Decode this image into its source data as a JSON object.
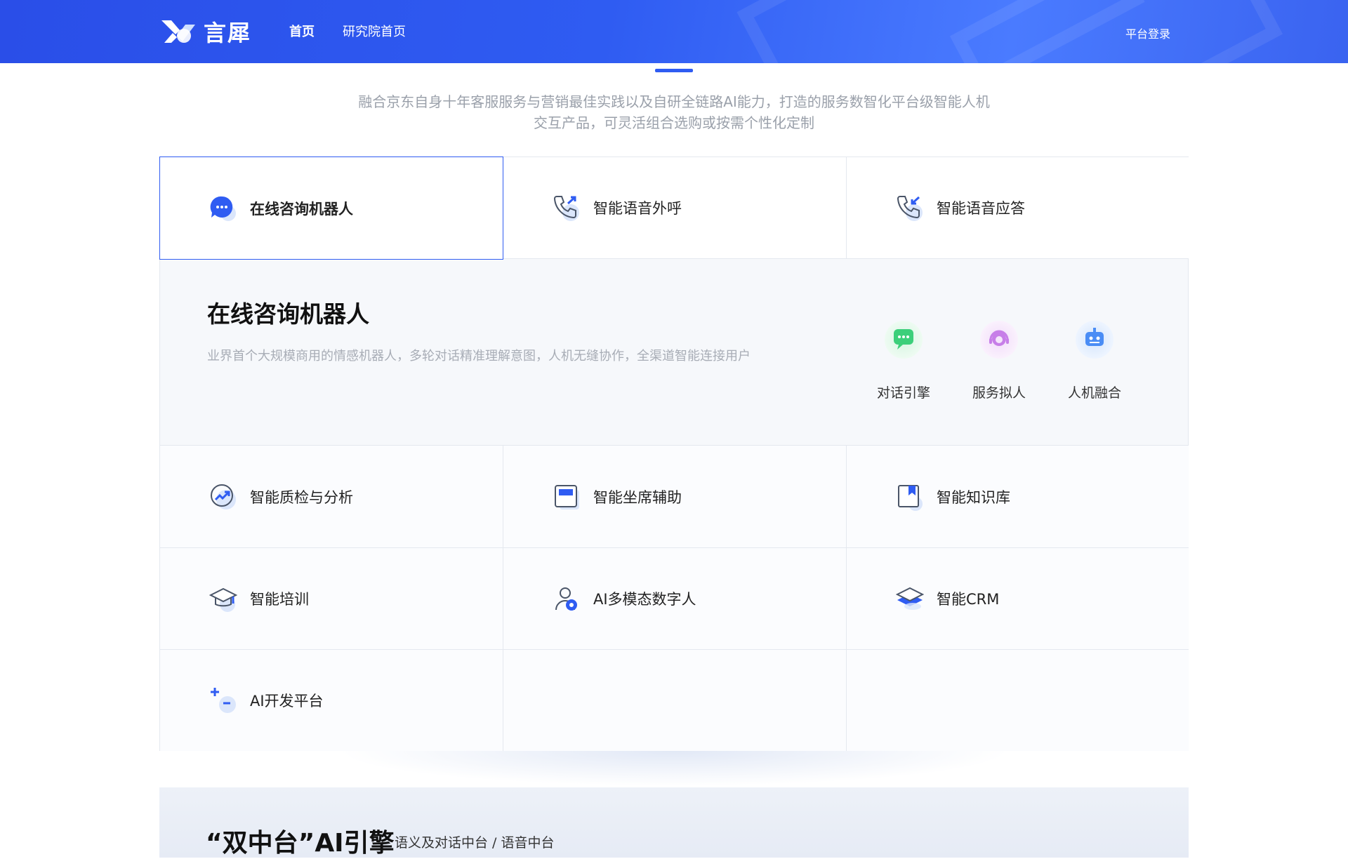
{
  "header": {
    "logo_text": "言犀",
    "nav": [
      {
        "label": "首页"
      },
      {
        "label": "研究院首页"
      }
    ],
    "login_label": "平台登录"
  },
  "intro": {
    "line1": "融合京东自身十年客服服务与营销最佳实践以及自研全链路AI能力，打造的服务数智化平台级智能人机",
    "line2": "交互产品，可灵活组合选购或按需个性化定制"
  },
  "products": {
    "tabs": [
      {
        "label": "在线咨询机器人",
        "icon": "chat-bubble-icon"
      },
      {
        "label": "智能语音外呼",
        "icon": "phone-outgoing-icon"
      },
      {
        "label": "智能语音应答",
        "icon": "phone-incoming-icon"
      }
    ],
    "detail": {
      "title": "在线咨询机器人",
      "description": "业界首个大规模商用的情感机器人，多轮对话精准理解意图，人机无缝协作，全渠道智能连接用户",
      "features": [
        {
          "label": "对话引擎",
          "icon": "dialog-engine-icon",
          "color": "#3ccf7a"
        },
        {
          "label": "服务拟人",
          "icon": "customer-service-icon",
          "color": "#c77ee8"
        },
        {
          "label": "人机融合",
          "icon": "robot-icon",
          "color": "#4a8df5"
        }
      ]
    },
    "items": [
      {
        "label": "智能质检与分析",
        "icon": "trend-chart-icon"
      },
      {
        "label": "智能坐席辅助",
        "icon": "window-panel-icon"
      },
      {
        "label": "智能知识库",
        "icon": "bookmark-book-icon"
      },
      {
        "label": "智能培训",
        "icon": "graduation-cap-icon"
      },
      {
        "label": "AI多模态数字人",
        "icon": "digital-human-icon"
      },
      {
        "label": "智能CRM",
        "icon": "layers-icon"
      },
      {
        "label": "AI开发平台",
        "icon": "plus-minus-icon"
      }
    ]
  },
  "teaser": {
    "title": "“双中台”AI引擎",
    "subtitle": "语义及对话中台 / 语音中台"
  },
  "colors": {
    "brand_blue": "#2f5cf2",
    "grid_border": "#e4e8ef",
    "muted_text": "#9aa0aa"
  }
}
